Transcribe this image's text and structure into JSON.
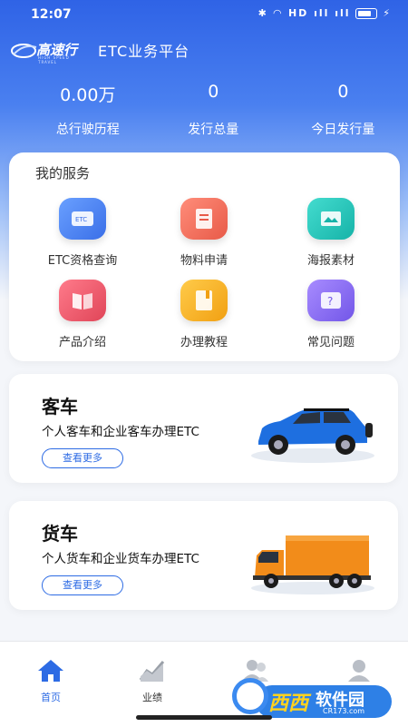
{
  "status_bar": {
    "time": "12:07",
    "icons": "✱ ◠ HD ıll ıll"
  },
  "header": {
    "logo_text": "高速行",
    "logo_sub": "HIGH SPEED TRAVEL",
    "app_title": "ETC业务平台"
  },
  "stats": [
    {
      "value": "0.00万",
      "label": "总行驶历程"
    },
    {
      "value": "0",
      "label": "发行总量"
    },
    {
      "value": "0",
      "label": "今日发行量"
    }
  ],
  "services": {
    "title": "我的服务",
    "items": [
      {
        "label": "ETC资格查询",
        "icon": "etc-card-icon",
        "color": "#4f86f2"
      },
      {
        "label": "物料申请",
        "icon": "document-icon",
        "color": "#ef6a5a"
      },
      {
        "label": "海报素材",
        "icon": "poster-icon",
        "color": "#21c4b9"
      },
      {
        "label": "产品介绍",
        "icon": "book-icon",
        "color": "#ee5a6a"
      },
      {
        "label": "办理教程",
        "icon": "tutorial-icon",
        "color": "#f6b21d"
      },
      {
        "label": "常见问题",
        "icon": "faq-icon",
        "color": "#8a6cf2"
      }
    ]
  },
  "cards": [
    {
      "title": "客车",
      "desc": "个人客车和企业客车办理ETC",
      "button": "查看更多",
      "image": "blue-suv-image"
    },
    {
      "title": "货车",
      "desc": "个人货车和企业货车办理ETC",
      "button": "查看更多",
      "image": "orange-truck-image"
    }
  ],
  "tabbar": [
    {
      "label": "首页",
      "icon": "home-icon",
      "active": true
    },
    {
      "label": "业绩",
      "icon": "chart-icon",
      "active": false
    },
    {
      "label": "",
      "icon": "team-icon",
      "active": false
    },
    {
      "label": "我的",
      "icon": "profile-icon",
      "active": false
    }
  ],
  "watermark": {
    "text_a": "西西",
    "text_b": "软件园",
    "url": "CR173.com"
  },
  "colors": {
    "primary": "#2d6be4",
    "header_gradient_top": "#2f63e6"
  }
}
